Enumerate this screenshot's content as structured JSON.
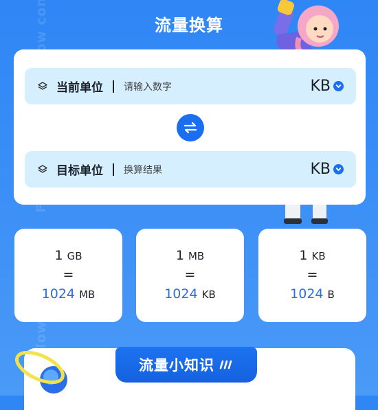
{
  "background_text": "Flow conversion",
  "header": {
    "title": "流量换算"
  },
  "converter": {
    "current": {
      "label": "当前单位",
      "placeholder": "请输入数字",
      "unit": "KB"
    },
    "target": {
      "label": "目标单位",
      "result": "换算结果",
      "unit": "KB"
    }
  },
  "examples": [
    {
      "from_value": "1",
      "from_unit": "GB",
      "equals": "=",
      "to_value": "1024",
      "to_unit": "MB"
    },
    {
      "from_value": "1",
      "from_unit": "MB",
      "equals": "=",
      "to_value": "1024",
      "to_unit": "KB"
    },
    {
      "from_value": "1",
      "from_unit": "KB",
      "equals": "=",
      "to_value": "1024",
      "to_unit": "B"
    }
  ],
  "knowledge": {
    "title": "流量小知识"
  },
  "colors": {
    "accent": "#1a6ff0",
    "row_bg": "#d6efff",
    "result_blue": "#2b6fe0"
  }
}
